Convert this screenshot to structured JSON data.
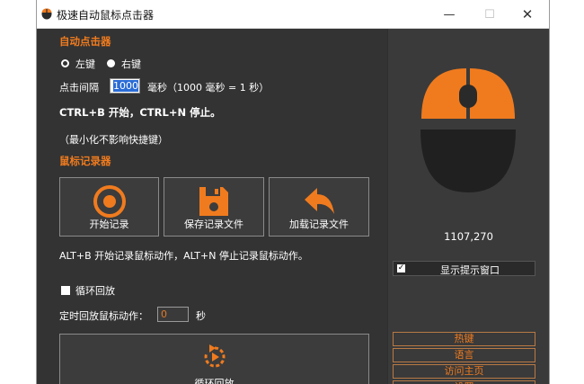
{
  "window": {
    "title": "极速自动鼠标点击器",
    "min_symbol": "—",
    "max_symbol": "☐",
    "close_symbol": "✕",
    "icon": "mouse-app-icon"
  },
  "auto_clicker": {
    "heading": "自动点击器",
    "left_label": "左键",
    "right_label": "右键",
    "selected": "left",
    "interval_label": "点击间隔",
    "interval_value": "1000",
    "interval_unit": "毫秒（1000 毫秒 = 1 秒）",
    "hotkey_text": "CTRL+B 开始，CTRL+N 停止。",
    "note": "（最小化不影响快捷键）"
  },
  "recorder": {
    "heading": "鼠标记录器",
    "buttons": [
      {
        "label": "开始记录",
        "icon": "record-icon"
      },
      {
        "label": "保存记录文件",
        "icon": "floppy-disk-icon"
      },
      {
        "label": "加载记录文件",
        "icon": "reply-arrow-icon"
      }
    ],
    "hotkey_text": "ALT+B 开始记录鼠标动作，ALT+N 停止记录鼠标动作。",
    "loop_label": "循环回放",
    "timer_label": "定时回放鼠标动作：",
    "timer_value": "0",
    "timer_unit": "秒",
    "loop_button_label": "循环回放",
    "loop_button_icon": "loop-replay-icon"
  },
  "side": {
    "mouse_icon": "mouse-graphic-icon",
    "coords": "1107,270",
    "show_tip_label": "显示提示窗口",
    "show_tip_checked": true,
    "buttons": [
      "热键",
      "语言",
      "访问主页",
      "设置"
    ]
  },
  "colors": {
    "accent": "#f07b1e",
    "panel": "#333333",
    "side_panel": "#3a3a3a"
  }
}
